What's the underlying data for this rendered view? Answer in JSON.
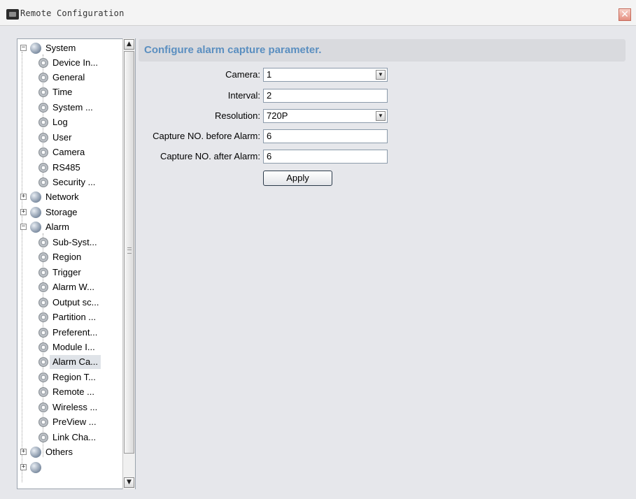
{
  "window": {
    "title": "Remote Configuration",
    "close_glyph": "✕"
  },
  "tree": {
    "system": {
      "label": "System",
      "children": [
        "Device In...",
        "General",
        "Time",
        "System ...",
        "Log",
        "User",
        "Camera",
        "RS485",
        "Security ..."
      ]
    },
    "network": {
      "label": "Network"
    },
    "storage": {
      "label": "Storage"
    },
    "alarm": {
      "label": "Alarm",
      "children": [
        "Sub-Syst...",
        "Region",
        "Trigger",
        "Alarm W...",
        "Output sc...",
        "Partition ...",
        "Preferent...",
        "Module I...",
        "Alarm Ca...",
        "Region T...",
        "Remote ...",
        "Wireless ...",
        "PreView ...",
        "Link Cha..."
      ]
    },
    "others": {
      "label": "Others"
    },
    "selected": "Alarm Ca..."
  },
  "main": {
    "header": "Configure alarm capture parameter.",
    "camera": {
      "label": "Camera:",
      "value": "1"
    },
    "interval": {
      "label": "Interval:",
      "value": "2"
    },
    "resolution": {
      "label": "Resolution:",
      "value": "720P"
    },
    "capture_before": {
      "label": "Capture NO. before Alarm:",
      "value": "6"
    },
    "capture_after": {
      "label": "Capture NO. after Alarm:",
      "value": "6"
    },
    "apply": "Apply"
  },
  "icons": {
    "folder": "globe-icon",
    "leaf": "gear-icon"
  }
}
